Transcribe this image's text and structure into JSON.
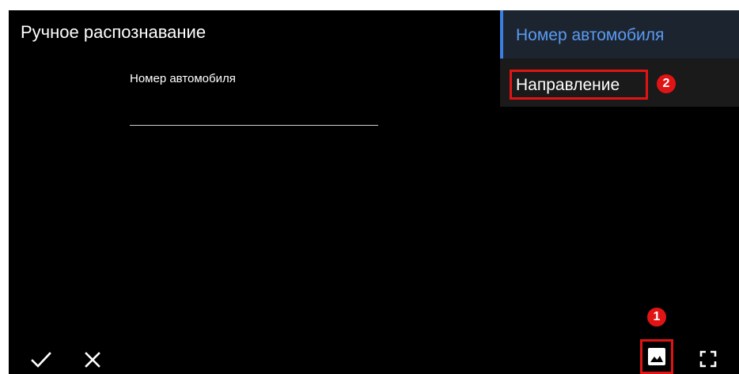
{
  "dialog": {
    "title": "Ручное распознавание",
    "field_label": "Номер автомобиля",
    "field_value": ""
  },
  "side_menu": {
    "items": [
      {
        "label": "Номер автомобиля",
        "active": true
      },
      {
        "label": "Направление",
        "active": false
      }
    ]
  },
  "badges": {
    "one": "1",
    "two": "2"
  },
  "toolbar": {
    "icons": [
      "check-icon",
      "close-icon",
      "image-icon",
      "fullscreen-icon"
    ]
  },
  "colors": {
    "background": "#000000",
    "accent": "#3d7fe0",
    "active_tab_text": "#5a9bf2",
    "highlight": "#e01414"
  }
}
